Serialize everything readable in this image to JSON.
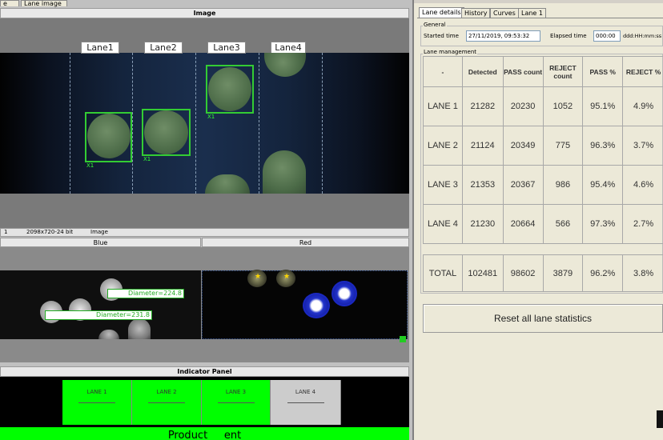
{
  "top_tabs": [
    "e",
    "Lane image"
  ],
  "image_panel": {
    "title": "Image",
    "lanes": [
      "Lane1",
      "Lane2",
      "Lane3",
      "Lane4"
    ],
    "tags": [
      "X1",
      "X1",
      "X1"
    ]
  },
  "status_bar": {
    "index": "1",
    "resolution": "2098x720-24 bit",
    "label": "Image"
  },
  "channels": {
    "blue_title": "Blue",
    "red_title": "Red",
    "measure_1": "Diameter=224.8",
    "measure_2": "Diameter=231.8"
  },
  "indicator": {
    "title": "Indicator Panel",
    "lanes": [
      {
        "label": "LANE 1",
        "color": "#00ff00"
      },
      {
        "label": "LANE 2",
        "color": "#00ff00"
      },
      {
        "label": "LANE 3",
        "color": "#00ff00"
      },
      {
        "label": "LANE 4",
        "color": "#cccccc"
      }
    ],
    "bottom_text": "Product     ent"
  },
  "right": {
    "tabs": [
      "Lane details",
      "History",
      "Curves",
      "Lane 1"
    ],
    "general_legend": "General",
    "started_label": "Started time",
    "started_value": "27/11/2019, 09:53:32",
    "elapsed_label": "Elapsed time",
    "elapsed_value": "000:00",
    "elapsed_format": "ddd:HH:mm:ss",
    "management_legend": "Lane management",
    "columns": [
      "-",
      "Detected",
      "PASS count",
      "REJECT count",
      "PASS %",
      "REJECT %"
    ],
    "rows": [
      [
        "LANE 1",
        "21282",
        "20230",
        "1052",
        "95.1%",
        "4.9%"
      ],
      [
        "LANE 2",
        "21124",
        "20349",
        "775",
        "96.3%",
        "3.7%"
      ],
      [
        "LANE 3",
        "21353",
        "20367",
        "986",
        "95.4%",
        "4.6%"
      ],
      [
        "LANE 4",
        "21230",
        "20664",
        "566",
        "97.3%",
        "2.7%"
      ]
    ],
    "total": [
      "TOTAL",
      "102481",
      "98602",
      "3879",
      "96.2%",
      "3.8%"
    ],
    "reset_label": "Reset all lane statistics"
  }
}
